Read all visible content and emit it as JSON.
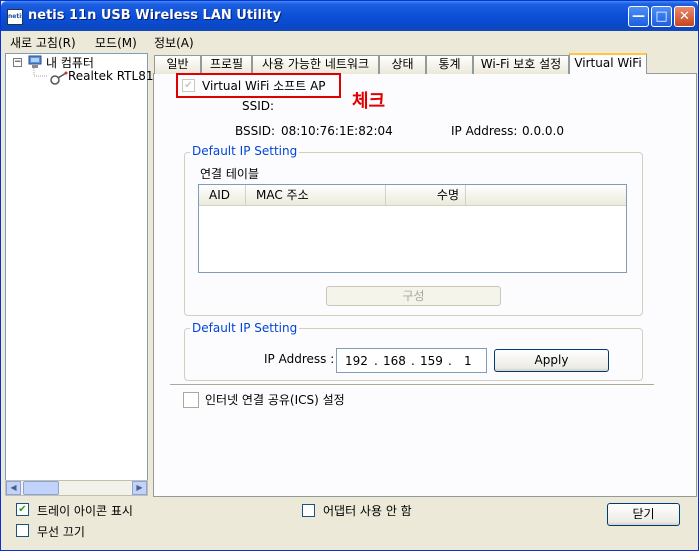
{
  "window": {
    "title": "netis 11n USB Wireless LAN Utility",
    "icon_text": "netis",
    "buttons": {
      "minimize": "—",
      "maximize": "□",
      "close": "✕"
    }
  },
  "menu": {
    "items": [
      "새로 고침(R)",
      "모드(M)",
      "정보(A)"
    ]
  },
  "tree": {
    "root": "내 컴퓨터",
    "child": "Realtek RTL81"
  },
  "tabs": [
    "일반",
    "프로필",
    "사용 가능한 네트워크",
    "상태",
    "통계",
    "Wi-Fi 보호 설정",
    "Virtual WiFi"
  ],
  "virtual_wifi": {
    "softap_label": "Virtual WiFi 소프트 AP",
    "softap_checked": true,
    "annotation": "체크",
    "ssid_label": "SSID:",
    "ssid_value": "",
    "bssid_label": "BSSID:",
    "bssid_value": "08:10:76:1E:82:04",
    "ip_label": "IP Address:",
    "ip_value": "0.0.0.0"
  },
  "group1": {
    "title": "Default IP Setting",
    "table_label": "연결 테이블",
    "columns": [
      "AID",
      "MAC 주소",
      "수명"
    ],
    "config_button": "구성"
  },
  "group2": {
    "title": "Default IP Setting",
    "ip_label": "IP Address :",
    "ip_octets": [
      "192",
      "168",
      "159",
      "1"
    ],
    "ip_dot": ".",
    "apply_button": "Apply"
  },
  "ics": {
    "label": "인터넷 연결 공유(ICS) 설정",
    "checked": false
  },
  "footer": {
    "tray_label": "트레이 아이콘 표시",
    "tray_checked": true,
    "radio_off_label": "무선 끄기",
    "radio_off_checked": false,
    "disable_adapter_label": "어댑터 사용 안 함",
    "disable_adapter_checked": false,
    "close_button": "닫기"
  }
}
